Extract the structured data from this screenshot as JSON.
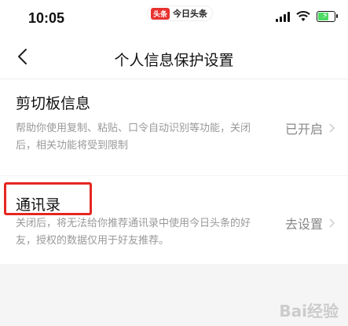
{
  "status_bar": {
    "time": "10:05",
    "app_pill": {
      "logo_text": "头条",
      "label": "今日头条"
    },
    "battery_color": "#4cd964"
  },
  "nav": {
    "title": "个人信息保护设置",
    "back_icon": "chevron-left-icon"
  },
  "sections": [
    {
      "title": "剪切板信息",
      "description": "帮助你使用复制、粘贴、口令自动识别等功能，关闭后，相关功能将受到限制",
      "action": "已开启"
    },
    {
      "title": "通讯录",
      "description": "关闭后，将无法给你推荐通讯录中使用今日头条的好友，授权的数据仅用于好友推荐。",
      "action": "去设置"
    }
  ],
  "highlight_color": "#e52620",
  "watermark": "Bai经验"
}
